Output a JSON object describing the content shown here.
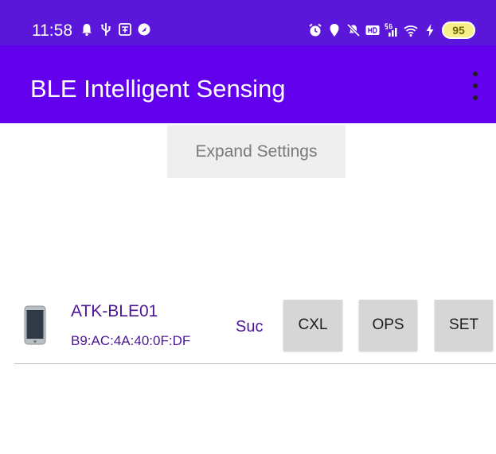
{
  "status_bar": {
    "time": "11:58",
    "left_icons": [
      "notification-bell-icon",
      "usb-icon",
      "translate-icon",
      "navigation-icon"
    ],
    "right_icons": [
      "alarm-icon",
      "location-icon",
      "mute-icon",
      "hd-icon",
      "signal-5g-icon",
      "wifi-icon",
      "charging-icon"
    ],
    "battery": "95"
  },
  "app_bar": {
    "title": "BLE Intelligent Sensing"
  },
  "main": {
    "expand_button_label": "Expand Settings",
    "device": {
      "name": "ATK-BLE01",
      "mac": "B9:AC:4A:40:0F:DF",
      "status": "Suc",
      "buttons": {
        "cxl": "CXL",
        "ops": "OPS",
        "set": "SET"
      }
    }
  }
}
